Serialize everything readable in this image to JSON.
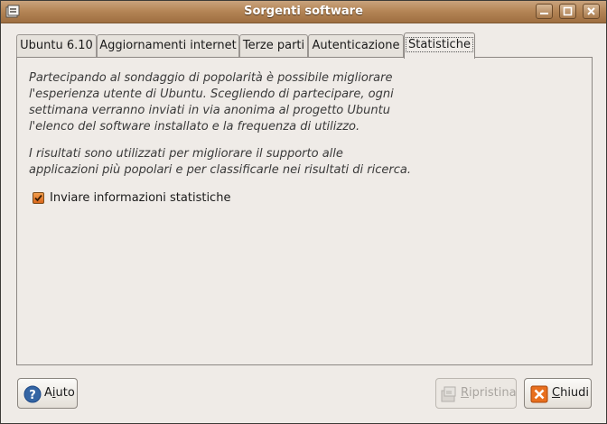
{
  "window": {
    "title": "Sorgenti software",
    "icon": "software-sources-icon",
    "controls": [
      "minimize-icon",
      "maximize-icon",
      "close-icon"
    ]
  },
  "tabs": [
    {
      "label": "Ubuntu 6.10",
      "active": false
    },
    {
      "label": "Aggiornamenti internet",
      "active": false
    },
    {
      "label": "Terze parti",
      "active": false
    },
    {
      "label": "Autenticazione",
      "active": false
    },
    {
      "label": "Statistiche",
      "active": true
    }
  ],
  "panel": {
    "paragraph1": "Partecipando al sondaggio di popolarità è possibile migliorare\nl'esperienza utente di Ubuntu. Scegliendo di partecipare, ogni\nsettimana verranno inviati in via anonima al progetto Ubuntu\nl'elenco del software installato e la frequenza di utilizzo.",
    "paragraph2": "I risultati sono utilizzati per migliorare il supporto alle\napplicazioni più popolari e per classificarle nei risultati di ricerca.",
    "checkbox": {
      "label": "Inviare informazioni statistiche",
      "checked": true
    }
  },
  "buttons": {
    "help": {
      "pre": "A",
      "mnemonic": "i",
      "post": "uto",
      "icon": "help-icon"
    },
    "revert": {
      "pre": "",
      "mnemonic": "R",
      "post": "ipristina",
      "icon": "revert-icon",
      "enabled": false
    },
    "close": {
      "pre": "",
      "mnemonic": "C",
      "post": "hiudi",
      "icon": "close-icon"
    }
  },
  "colors": {
    "titlebar": "#b58657",
    "checkbox": "#e77a2a",
    "window_bg": "#efebe7"
  }
}
